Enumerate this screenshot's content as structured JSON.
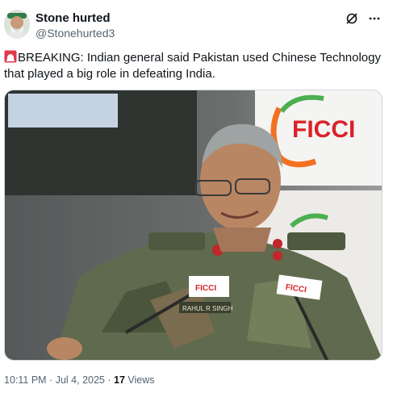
{
  "author": {
    "display_name": "Stone hurted",
    "handle": "@Stonehurted3"
  },
  "icons": {
    "top_right": [
      "grok-icon",
      "more-options-icon"
    ],
    "prefix": "siren-icon"
  },
  "tweet": {
    "text": "BREAKING: Indian general said Pakistan used Chinese Technology that played a big role in defeating India."
  },
  "media": {
    "backdrop_logo": "FICCI",
    "mic_label_left": "FICCI",
    "mic_label_right": "FICCI",
    "name_tag": "RAHUL R SINGH"
  },
  "meta": {
    "time": "10:11 PM",
    "separator": "·",
    "date": "Jul 4, 2025",
    "views_count": "17",
    "views_label": "Views"
  },
  "colors": {
    "text_primary": "#0f1419",
    "text_secondary": "#536471",
    "ficci_red": "#d8232a",
    "ficci_orange": "#f37021",
    "ficci_green": "#4caf50"
  }
}
